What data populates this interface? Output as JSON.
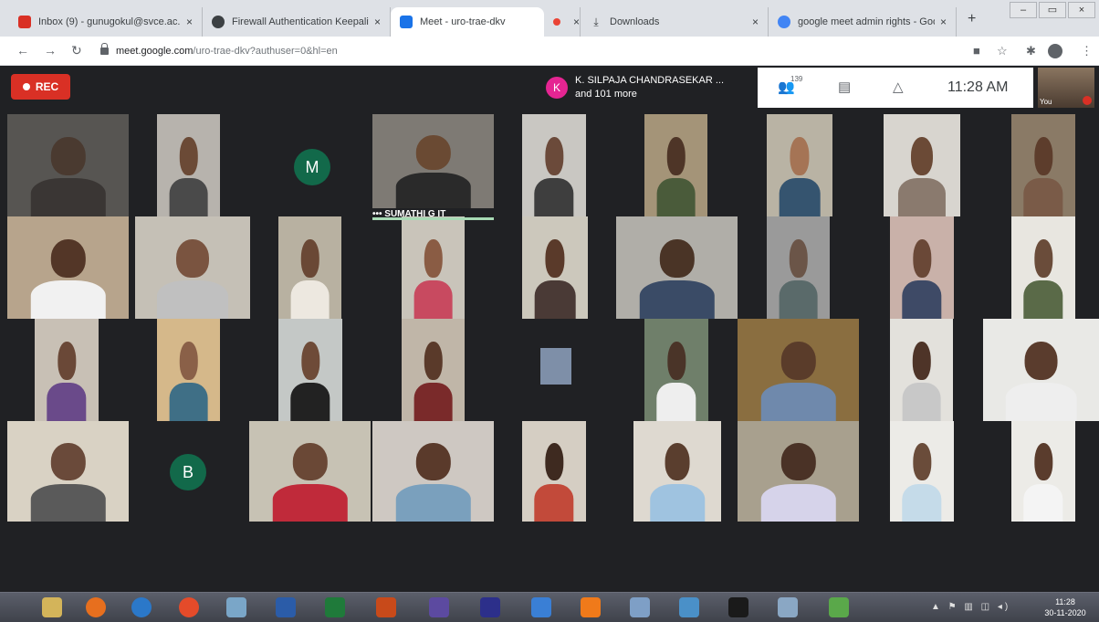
{
  "browser": {
    "tabs": [
      {
        "title": "Inbox (9) - gunugokul@svce.ac.i",
        "close": "×",
        "fav_color": "#d93025"
      },
      {
        "title": "Firewall Authentication Keepaliv",
        "close": "×",
        "fav_color": "#3c4043"
      },
      {
        "title": "Meet - uro-trae-dkv",
        "close": "×",
        "fav_color": "#1a73e8",
        "active": true
      },
      {
        "title": "",
        "close": "×",
        "fav_color": "#ea4335"
      },
      {
        "title": "Downloads",
        "close": "×",
        "fav_color": "#ffffff"
      },
      {
        "title": "google meet admin rights - Goo",
        "close": "×",
        "fav_color": "#4285f4"
      }
    ],
    "new_tab": "+",
    "window_controls": [
      "–",
      "▭",
      "×"
    ],
    "url_host": "meet.google.com",
    "url_path": "/uro-trae-dkv?authuser=0&hl=en"
  },
  "meet": {
    "recording_label": "REC",
    "presenter_initial": "K",
    "presenter_line1": "K. SILPAJA CHANDRASEKAR ...",
    "presenter_line2": "and 101 more",
    "participant_count": "139",
    "time": "11:28 AM",
    "self_label": "You",
    "speaker_name": "SUMATHI G IT",
    "initial_tiles": [
      "M",
      "B"
    ],
    "tiles": [
      {
        "bg": "#575552",
        "skin": "#4a3a30",
        "shirt": "#3a3634"
      },
      {
        "bg": "#b7b3ad",
        "skin": "#6b4a36",
        "shirt": "#4a4a4a"
      },
      {
        "bg": "#7e7a74",
        "skin": "#6a4a33",
        "shirt": "#2a2a2a"
      },
      {
        "bg": "#c9c7c2",
        "skin": "#6b4a3a",
        "shirt": "#3e3e3e"
      },
      {
        "bg": "#a49478",
        "skin": "#4e3527",
        "shirt": "#4a5b3a"
      },
      {
        "bg": "#b9b3a4",
        "skin": "#a57455",
        "shirt": "#35546f"
      },
      {
        "bg": "#d8d5cf",
        "skin": "#6b4a36",
        "shirt": "#8a7a6e"
      },
      {
        "bg": "#8a7a66",
        "skin": "#5d3d2c",
        "shirt": "#7a5b48"
      },
      {
        "bg": "#b7a48c",
        "skin": "#533627",
        "shirt": "#f1f1f1"
      },
      {
        "bg": "#c5c0b6",
        "skin": "#7a5440",
        "shirt": "#c0c0c0"
      },
      {
        "bg": "#b8b1a1",
        "skin": "#6a4835",
        "shirt": "#ede8e0"
      },
      {
        "bg": "#c9c4ba",
        "skin": "#8a5c44",
        "shirt": "#c84a60"
      },
      {
        "bg": "#ccc8bc",
        "skin": "#5a3a2a",
        "shirt": "#4a3a36"
      },
      {
        "bg": "#b0aea8",
        "skin": "#4a3426",
        "shirt": "#3a4b66"
      },
      {
        "bg": "#9a9a9a",
        "skin": "#6b5548",
        "shirt": "#5a6a6a"
      },
      {
        "bg": "#c9b1a9",
        "skin": "#6a4837",
        "shirt": "#3e4a66"
      },
      {
        "bg": "#e8e6e0",
        "skin": "#6a4c3a",
        "shirt": "#5a6a48"
      },
      {
        "bg": "#c8c0b5",
        "skin": "#6a4837",
        "shirt": "#6a4a8a"
      },
      {
        "bg": "#d5b88a",
        "skin": "#8a6048",
        "shirt": "#3f6f86"
      },
      {
        "bg": "#c4c8c6",
        "skin": "#6e4b38",
        "shirt": "#222222"
      },
      {
        "bg": "#c0b6a8",
        "skin": "#5a3a2a",
        "shirt": "#7a2a2a"
      },
      {
        "bg": "#6f7f6a",
        "skin": "#4a3428",
        "shirt": "#eeeeee"
      },
      {
        "bg": "#8a6e40",
        "skin": "#5a3c2a",
        "shirt": "#6f89ac"
      },
      {
        "bg": "#e3e1dc",
        "skin": "#4e3428",
        "shirt": "#c8c8c8"
      },
      {
        "bg": "#e9e9e6",
        "skin": "#5a3c2d",
        "shirt": "#eeeeee"
      },
      {
        "bg": "#d9d2c4",
        "skin": "#6a4a3a",
        "shirt": "#5a5a5a"
      },
      {
        "bg": "#c7c2b4",
        "skin": "#6a4836",
        "shirt": "#c02a3a"
      },
      {
        "bg": "#cec8c2",
        "skin": "#5a3a2b",
        "shirt": "#7aa0bd"
      },
      {
        "bg": "#d5cec3",
        "skin": "#3e2a20",
        "shirt": "#c24a3a"
      },
      {
        "bg": "#ded9d0",
        "skin": "#5a3e2e",
        "shirt": "#9fc3e0"
      },
      {
        "bg": "#a8a08e",
        "skin": "#4a3226",
        "shirt": "#d6d3ea"
      },
      {
        "bg": "#ecebe7",
        "skin": "#6a4c3a",
        "shirt": "#c5dbe9"
      },
      {
        "bg": "#ecebe7",
        "skin": "#5a3c2d",
        "shirt": "#f4f4f4"
      }
    ]
  },
  "taskbar": {
    "icons": [
      "#d3b45a",
      "#e76f1e",
      "#2b78c9",
      "#e44b2a",
      "#7aa6c8",
      "#2b5ca8",
      "#1f7a3a",
      "#c84a1a",
      "#5c4aa0",
      "#2c2f8a",
      "#3a7fd5",
      "#f07a1a",
      "#7e9fc6",
      "#4a90c8",
      "#1a1a1a",
      "#8aa7c4",
      "#5aa84a"
    ],
    "time": "11:28",
    "date": "30-11-2020"
  }
}
